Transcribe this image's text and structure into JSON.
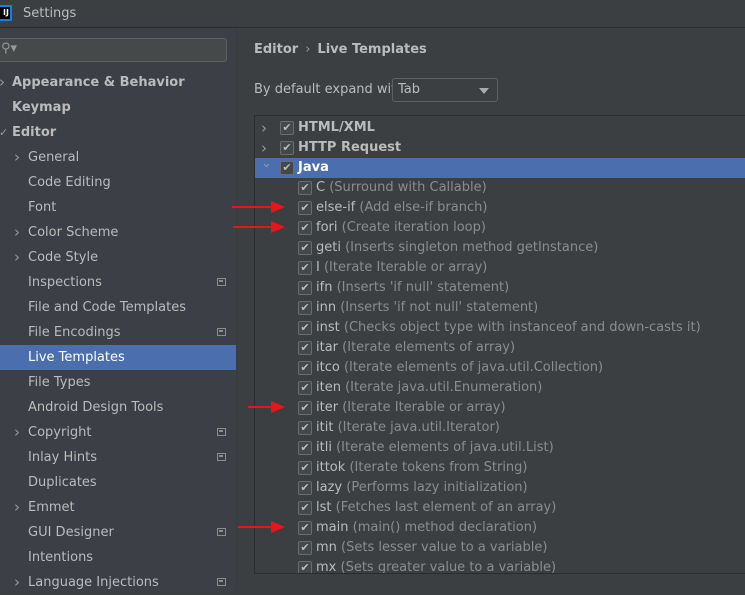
{
  "window": {
    "title": "Settings",
    "logo": "IJ"
  },
  "search": {
    "icon": "search-icon",
    "value": ""
  },
  "sidebar": {
    "items": [
      {
        "label": "Appearance & Behavior",
        "level": 0,
        "chevron": "right",
        "bold": true
      },
      {
        "label": "Keymap",
        "level": 0,
        "bold": true
      },
      {
        "label": "Editor",
        "level": 0,
        "chevron": "down",
        "bold": true
      },
      {
        "label": "General",
        "level": 1,
        "chevron": "right"
      },
      {
        "label": "Code Editing",
        "level": 1
      },
      {
        "label": "Font",
        "level": 1
      },
      {
        "label": "Color Scheme",
        "level": 1,
        "chevron": "right"
      },
      {
        "label": "Code Style",
        "level": 1,
        "chevron": "right"
      },
      {
        "label": "Inspections",
        "level": 1,
        "project": true
      },
      {
        "label": "File and Code Templates",
        "level": 1
      },
      {
        "label": "File Encodings",
        "level": 1,
        "project": true
      },
      {
        "label": "Live Templates",
        "level": 1,
        "selected": true
      },
      {
        "label": "File Types",
        "level": 1
      },
      {
        "label": "Android Design Tools",
        "level": 1
      },
      {
        "label": "Copyright",
        "level": 1,
        "chevron": "right",
        "project": true
      },
      {
        "label": "Inlay Hints",
        "level": 1,
        "project": true
      },
      {
        "label": "Duplicates",
        "level": 1
      },
      {
        "label": "Emmet",
        "level": 1,
        "chevron": "right"
      },
      {
        "label": "GUI Designer",
        "level": 1,
        "project": true
      },
      {
        "label": "Intentions",
        "level": 1
      },
      {
        "label": "Language Injections",
        "level": 1,
        "chevron": "right",
        "project": true
      }
    ]
  },
  "breadcrumb": {
    "parent": "Editor",
    "separator": "›",
    "current": "Live Templates"
  },
  "expand": {
    "label": "By default expand with",
    "value": "Tab"
  },
  "templates": [
    {
      "name": "HTML/XML",
      "group": true,
      "expanded": false,
      "checked": true
    },
    {
      "name": "HTTP Request",
      "group": true,
      "expanded": false,
      "checked": true
    },
    {
      "name": "Java",
      "group": true,
      "expanded": true,
      "checked": true,
      "selected": true
    },
    {
      "name": "C",
      "desc": "(Surround with Callable)",
      "checked": true
    },
    {
      "name": "else-if",
      "desc": "(Add else-if branch)",
      "checked": true,
      "arrow": true
    },
    {
      "name": "fori",
      "desc": "(Create iteration loop)",
      "checked": true,
      "arrow": true
    },
    {
      "name": "geti",
      "desc": "(Inserts singleton method getInstance)",
      "checked": true
    },
    {
      "name": "I",
      "desc": "(Iterate Iterable or array)",
      "checked": true
    },
    {
      "name": "ifn",
      "desc": "(Inserts 'if null' statement)",
      "checked": true
    },
    {
      "name": "inn",
      "desc": "(Inserts 'if not null' statement)",
      "checked": true
    },
    {
      "name": "inst",
      "desc": "(Checks object type with instanceof and down-casts it)",
      "checked": true
    },
    {
      "name": "itar",
      "desc": "(Iterate elements of array)",
      "checked": true
    },
    {
      "name": "itco",
      "desc": "(Iterate elements of java.util.Collection)",
      "checked": true
    },
    {
      "name": "iten",
      "desc": "(Iterate java.util.Enumeration)",
      "checked": true
    },
    {
      "name": "iter",
      "desc": "(Iterate Iterable or array)",
      "checked": true,
      "arrow": true
    },
    {
      "name": "itit",
      "desc": "(Iterate java.util.Iterator)",
      "checked": true
    },
    {
      "name": "itli",
      "desc": "(Iterate elements of java.util.List)",
      "checked": true
    },
    {
      "name": "ittok",
      "desc": "(Iterate tokens from String)",
      "checked": true
    },
    {
      "name": "lazy",
      "desc": "(Performs lazy initialization)",
      "checked": true
    },
    {
      "name": "lst",
      "desc": "(Fetches last element of an array)",
      "checked": true
    },
    {
      "name": "main",
      "desc": "(main() method declaration)",
      "checked": true,
      "arrow": true
    },
    {
      "name": "mn",
      "desc": "(Sets lesser value to a variable)",
      "checked": true
    },
    {
      "name": "mx",
      "desc": "(Sets greater value to a variable)",
      "checked": true
    }
  ],
  "colors": {
    "selection": "#4b6eaf",
    "annotation_arrow": "#e8141a"
  }
}
